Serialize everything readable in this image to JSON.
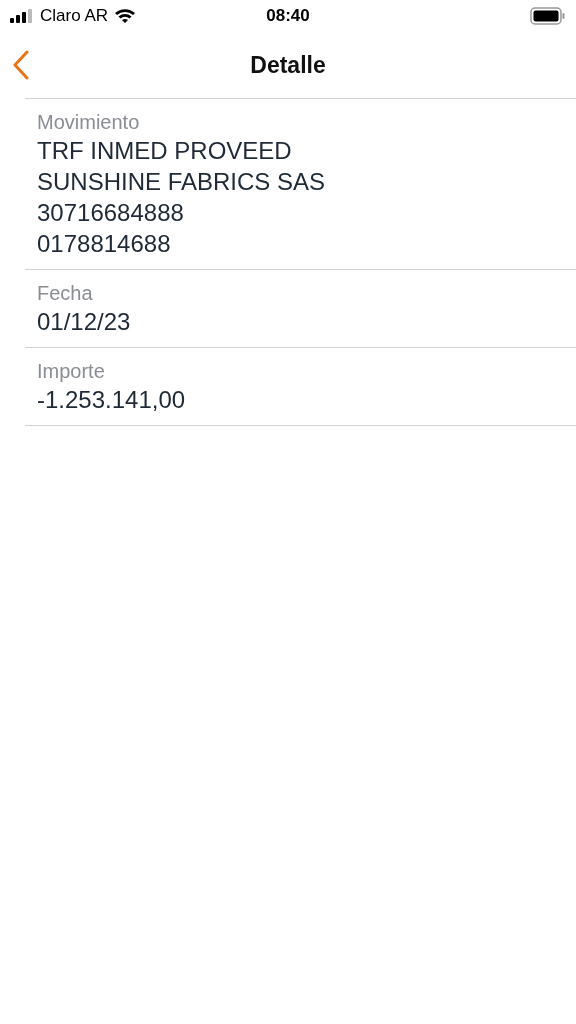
{
  "status_bar": {
    "carrier": "Claro AR",
    "time": "08:40"
  },
  "nav": {
    "title": "Detalle"
  },
  "fields": [
    {
      "label": "Movimiento",
      "lines": [
        "TRF INMED PROVEED",
        "SUNSHINE FABRICS SAS",
        "30716684888",
        "0178814688"
      ]
    },
    {
      "label": "Fecha",
      "lines": [
        "01/12/23"
      ]
    },
    {
      "label": "Importe",
      "lines": [
        "-1.253.141,00"
      ]
    }
  ]
}
